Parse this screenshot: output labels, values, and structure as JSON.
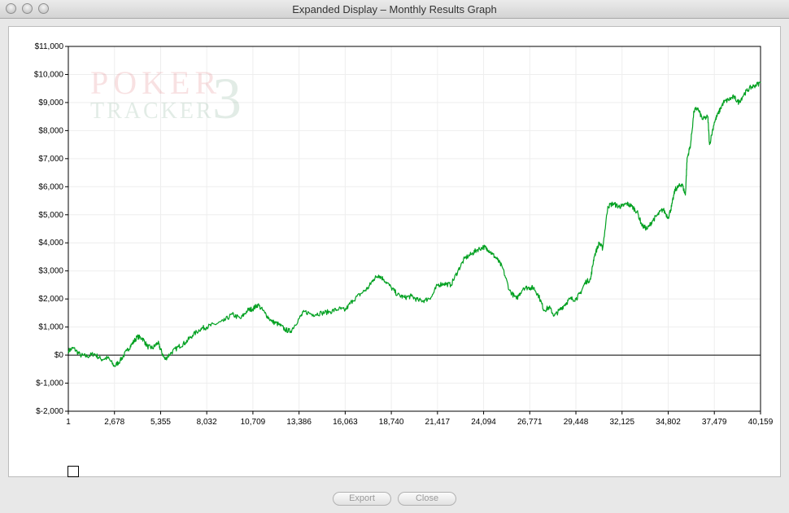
{
  "window": {
    "title": "Expanded Display – Monthly Results Graph"
  },
  "watermark": {
    "line1": "POKER",
    "line2": "TRACKER",
    "mark": "3"
  },
  "buttons": {
    "export_label": "Export",
    "close_label": "Close"
  },
  "colors": {
    "series": "#00a020",
    "axis": "#000000",
    "grid": "#eeeeee"
  },
  "chart_data": {
    "type": "line",
    "title": "",
    "xlabel": "",
    "ylabel": "",
    "grid": true,
    "xlim": [
      1,
      40159
    ],
    "ylim": [
      -2000,
      11000
    ],
    "x_ticks": [
      1,
      2678,
      5355,
      8032,
      10709,
      13386,
      16063,
      18740,
      21417,
      24094,
      26771,
      29448,
      32125,
      34802,
      37479,
      40159
    ],
    "x_tick_labels": [
      "1",
      "2,678",
      "5,355",
      "8,032",
      "10,709",
      "13,386",
      "16,063",
      "18,740",
      "21,417",
      "24,094",
      "26,771",
      "29,448",
      "32,125",
      "34,802",
      "37,479",
      "40,159"
    ],
    "y_ticks": [
      -2000,
      -1000,
      0,
      1000,
      2000,
      3000,
      4000,
      5000,
      6000,
      7000,
      8000,
      9000,
      10000,
      11000
    ],
    "y_tick_labels": [
      "$-2,000",
      "$-1,000",
      "$0",
      "$1,000",
      "$2,000",
      "$3,000",
      "$4,000",
      "$5,000",
      "$6,000",
      "$7,000",
      "$8,000",
      "$9,000",
      "$10,000",
      "$11,000"
    ],
    "series": [
      {
        "x": [
          1,
          300,
          700,
          1100,
          1500,
          1900,
          2300,
          2678,
          3000,
          3400,
          3700,
          4000,
          4300,
          4600,
          4900,
          5200,
          5355,
          5600,
          6000,
          6400,
          6800,
          7200,
          7700,
          8032,
          8500,
          9000,
          9500,
          10000,
          10400,
          10709,
          11000,
          11400,
          11800,
          12200,
          12600,
          12900,
          13386,
          13700,
          14200,
          14700,
          15200,
          15700,
          16063,
          16500,
          17000,
          17400,
          17700,
          18000,
          18300,
          18740,
          19100,
          19500,
          19900,
          20300,
          20700,
          21100,
          21417,
          21800,
          22200,
          22600,
          23000,
          23400,
          23700,
          24094,
          24300,
          24600,
          24900,
          25200,
          25600,
          26000,
          26400,
          26771,
          27000,
          27300,
          27600,
          27900,
          28200,
          28500,
          28800,
          29100,
          29448,
          29700,
          30000,
          30300,
          30500,
          30800,
          31000,
          31300,
          31600,
          31900,
          32125,
          32400,
          32700,
          33000,
          33300,
          33600,
          33900,
          34200,
          34500,
          34802,
          35000,
          35200,
          35400,
          35600,
          35800,
          35900,
          36100,
          36300,
          36500,
          36800,
          37100,
          37200,
          37479,
          37700,
          38000,
          38300,
          38600,
          38900,
          39200,
          39500,
          39800,
          40159
        ],
        "y": [
          150,
          250,
          0,
          -50,
          50,
          -150,
          -100,
          -400,
          -200,
          150,
          400,
          650,
          600,
          300,
          250,
          450,
          200,
          -150,
          100,
          300,
          450,
          700,
          950,
          1000,
          1100,
          1200,
          1450,
          1300,
          1600,
          1650,
          1800,
          1500,
          1200,
          1100,
          900,
          850,
          1300,
          1550,
          1450,
          1500,
          1550,
          1650,
          1600,
          1950,
          2200,
          2400,
          2700,
          2850,
          2700,
          2400,
          2150,
          2050,
          2100,
          1950,
          1950,
          2100,
          2500,
          2550,
          2500,
          3000,
          3450,
          3600,
          3750,
          3850,
          3800,
          3600,
          3400,
          3100,
          2300,
          2000,
          2400,
          2400,
          2400,
          2100,
          1600,
          1700,
          1400,
          1600,
          1800,
          2000,
          2000,
          2200,
          2600,
          2700,
          3500,
          4000,
          3800,
          5300,
          5400,
          5300,
          5300,
          5400,
          5300,
          5100,
          4600,
          4500,
          4800,
          5000,
          5200,
          4900,
          5300,
          5900,
          6000,
          6100,
          5700,
          7000,
          7500,
          8700,
          8800,
          8400,
          8500,
          7500,
          8300,
          8600,
          9000,
          9100,
          9200,
          9000,
          9300,
          9500,
          9600,
          9700
        ]
      }
    ]
  }
}
